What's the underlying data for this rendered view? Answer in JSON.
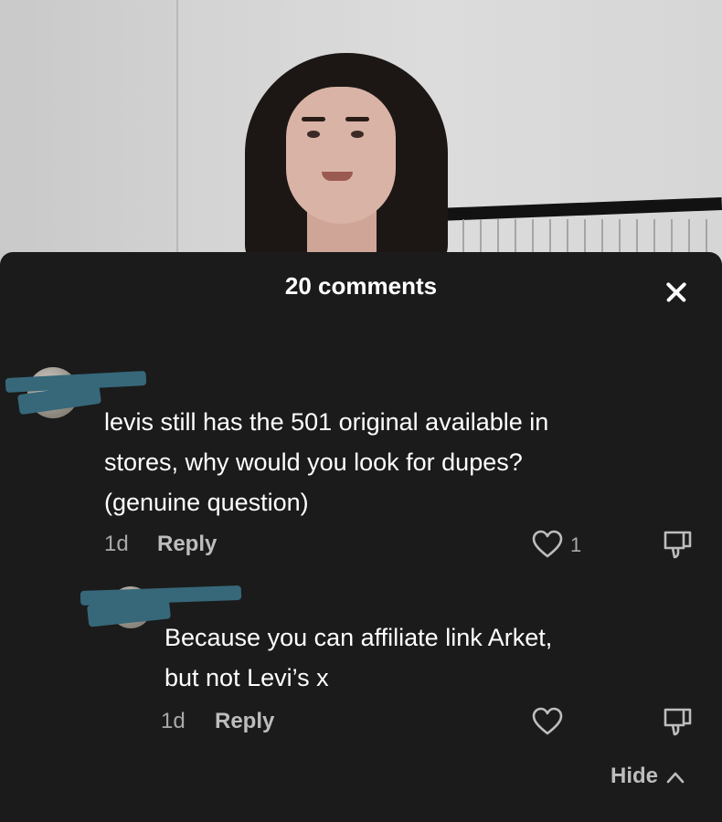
{
  "video": {
    "description_icon": "video-frame"
  },
  "sheet": {
    "title": "20 comments",
    "close_icon": "close-icon"
  },
  "comments": [
    {
      "text_lines": [
        "levis still has the 501 original available in",
        "stores, why would you look for dupes?",
        "(genuine question)"
      ],
      "age": "1d",
      "reply_label": "Reply",
      "like_count": "1"
    },
    {
      "text_lines": [
        "Because you can affiliate link Arket,",
        "but not Levi’s x"
      ],
      "age": "1d",
      "reply_label": "Reply",
      "like_count": ""
    }
  ],
  "hide_label": "Hide",
  "colors": {
    "sheet_bg": "#1b1b1b",
    "text": "#ffffff",
    "muted": "#a9a9a9",
    "redaction": "#36687a"
  }
}
